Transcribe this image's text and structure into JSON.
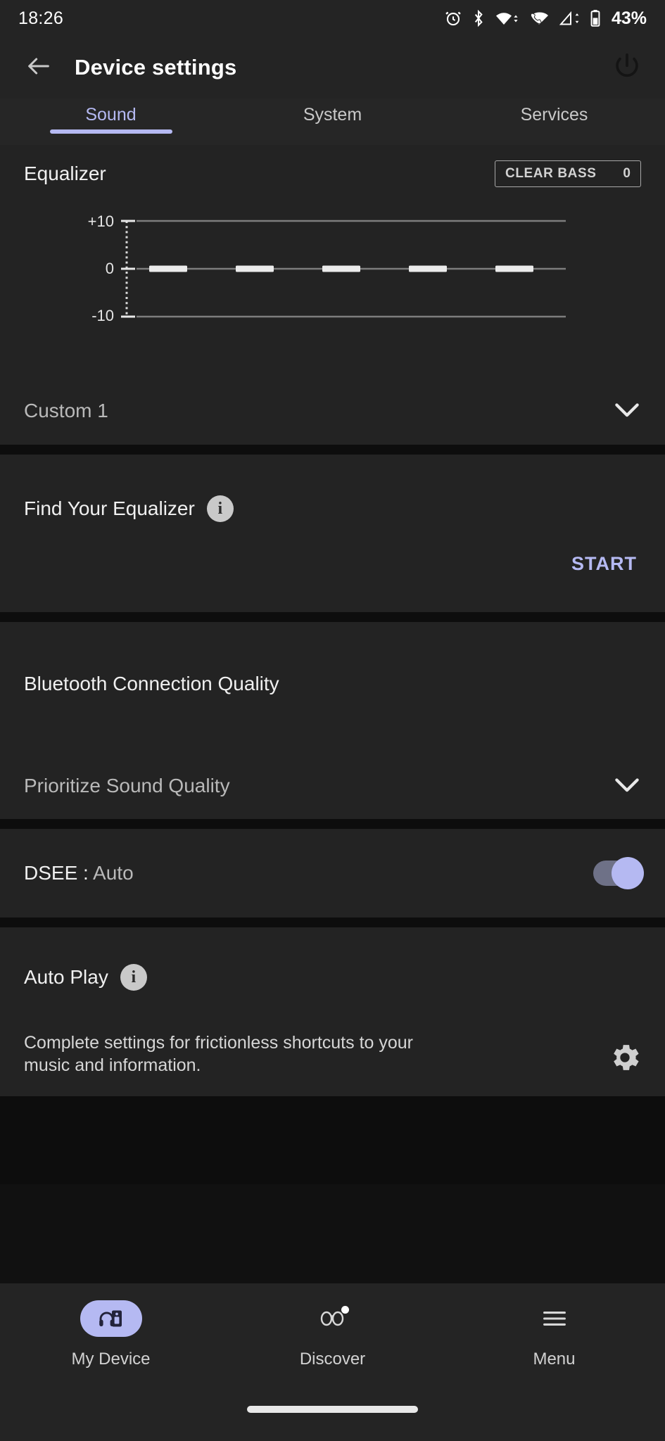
{
  "status_bar": {
    "time": "18:26",
    "battery_percent": "43%",
    "icons": [
      "alarm-icon",
      "bluetooth-icon",
      "wifi-icon",
      "wifi-calling-icon",
      "cellular-signal-icon",
      "battery-icon"
    ]
  },
  "app_bar": {
    "title": "Device settings",
    "back_icon": "arrow-left-icon",
    "power_icon": "power-icon"
  },
  "tabs": [
    {
      "label": "Sound",
      "active": true
    },
    {
      "label": "System",
      "active": false
    },
    {
      "label": "Services",
      "active": false
    }
  ],
  "equalizer": {
    "title": "Equalizer",
    "clear_bass_label": "CLEAR BASS",
    "clear_bass_value": "0",
    "axis_top_label": "+10",
    "axis_mid_label": "0",
    "axis_bottom_label": "-10",
    "preset_name": "Custom 1",
    "chevron_icon": "chevron-down-icon",
    "bands": [
      {
        "name": "band-1",
        "value": 0
      },
      {
        "name": "band-2",
        "value": 0
      },
      {
        "name": "band-3",
        "value": 0
      },
      {
        "name": "band-4",
        "value": 0
      },
      {
        "name": "band-5",
        "value": 0
      }
    ]
  },
  "find_your_equalizer": {
    "title": "Find Your Equalizer",
    "info_icon": "info-icon",
    "info_glyph": "i",
    "start_label": "START"
  },
  "bluetooth_quality": {
    "title": "Bluetooth Connection Quality",
    "selected_value": "Prioritize Sound Quality",
    "chevron_icon": "chevron-down-icon"
  },
  "dsee": {
    "label": "DSEE :",
    "value": "Auto",
    "toggle_on": true
  },
  "auto_play": {
    "title": "Auto Play",
    "info_icon": "info-icon",
    "info_glyph": "i",
    "description": "Complete settings for frictionless shortcuts to your music and information.",
    "gear_icon": "gear-icon"
  },
  "bottom_nav": [
    {
      "label": "My Device",
      "icon": "headphones-device-icon",
      "active": true,
      "badge": false
    },
    {
      "label": "Discover",
      "icon": "binoculars-icon",
      "active": false,
      "badge": true
    },
    {
      "label": "Menu",
      "icon": "hamburger-menu-icon",
      "active": false,
      "badge": false
    }
  ],
  "colors": {
    "accent": "#b5b9f2",
    "background": "#1c1c1c",
    "card": "#232323",
    "divider": "#0d0d0d"
  }
}
